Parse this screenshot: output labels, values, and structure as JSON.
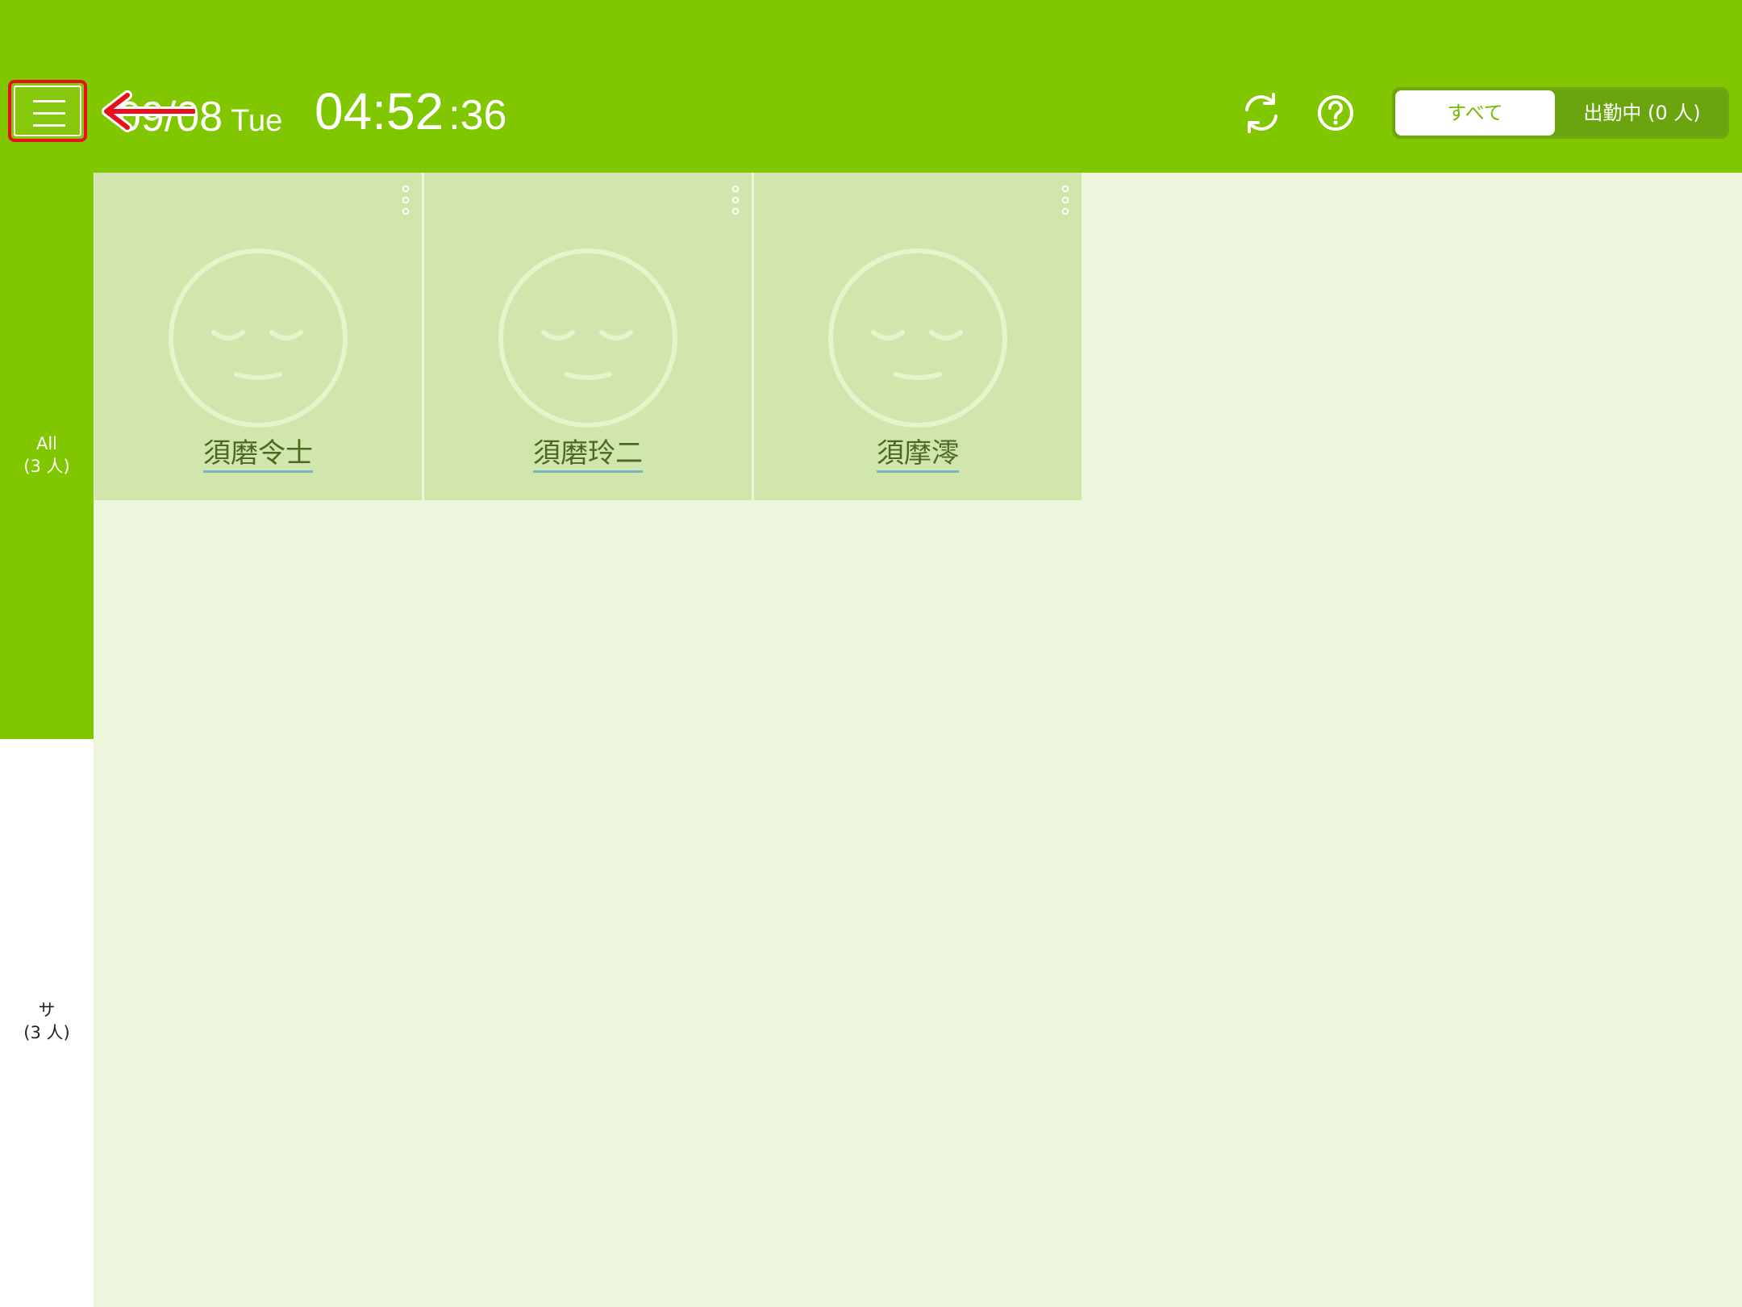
{
  "header": {
    "date": "09/08",
    "weekday": "Tue",
    "time": "04:52",
    "seconds": ":36",
    "filter_all_label": "すべて",
    "filter_working_label": "出勤中 (0 人)"
  },
  "sidebar": {
    "items": [
      {
        "name": "All",
        "count": "(3 人)",
        "active": true
      },
      {
        "name": "サ",
        "count": "(3 人)",
        "active": false
      }
    ]
  },
  "staff": [
    {
      "name": "須磨令士",
      "icon": "sleeping-face-icon"
    },
    {
      "name": "須磨玲二",
      "icon": "sleeping-face-icon"
    },
    {
      "name": "須摩澪",
      "icon": "sleeping-face-icon"
    }
  ],
  "icons": {
    "menu": "hamburger-menu-icon",
    "annotation": "red-arrow-left-icon",
    "refresh": "refresh-icon",
    "help": "help-circle-icon",
    "card_options": "vertical-dots-icon"
  },
  "colors": {
    "brand_green": "#80c700",
    "content_bg": "#edf6dc",
    "card_bg": "#d0e6ad",
    "annotation_red": "#e8101a"
  }
}
